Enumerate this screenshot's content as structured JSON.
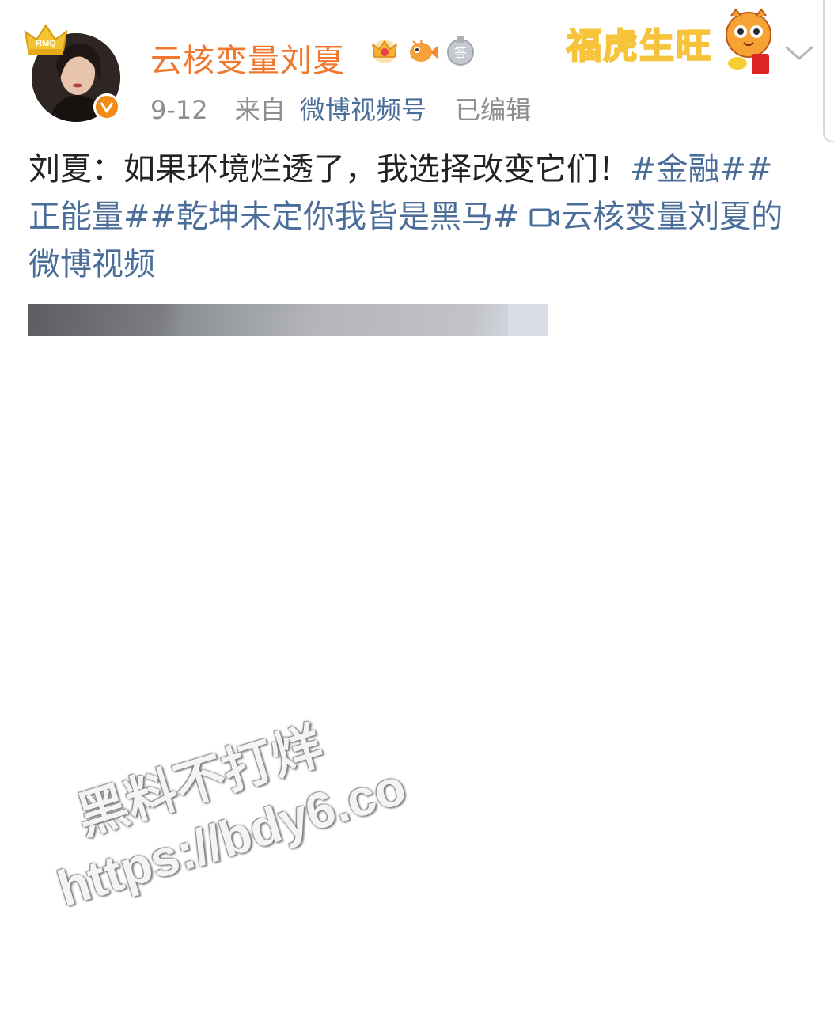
{
  "post": {
    "author": "云核变量刘夏",
    "date": "9-12",
    "from_label": "来自",
    "source": "微博视频号",
    "edited": "已编辑",
    "text_plain": "刘夏：如果环境烂透了，我选择改变它们！",
    "tag_1": "#金融#",
    "tag_2": "#正能量#",
    "tag_3": "#乾坤未定你我皆是黑马#",
    "video_link": "云核变量刘夏的微博视频"
  },
  "badges": [
    "crown-badge-icon",
    "fish-badge-icon",
    "answer-badge-icon"
  ],
  "festive_banner": "福虎生旺",
  "avatar_crown_text": "RMQ",
  "watermark": {
    "line1": "黑料不打烊",
    "line2": "https://bdy6.co"
  },
  "colors": {
    "username": "#f0782e",
    "link": "#4a6d9a",
    "meta": "#8e8e8e",
    "verified": "#f28a16"
  }
}
